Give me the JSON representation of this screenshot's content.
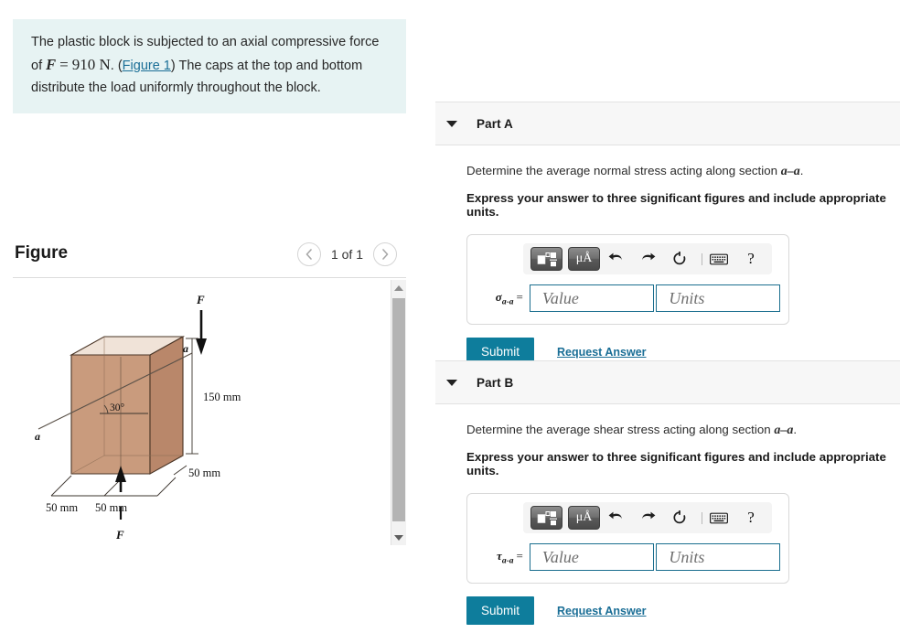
{
  "problem": {
    "text_before_var": "The plastic block is subjected to an axial compressive force of ",
    "force_var": "F",
    "equals": "=",
    "force_value": "910 N",
    "period": ".",
    "paren_open": "(",
    "figure_link": "Figure 1",
    "paren_close": ")",
    "text_after": " The caps at the top and bottom distribute the load uniformly throughout the block."
  },
  "figure": {
    "title": "Figure",
    "prev_icon": "chevron-left-icon",
    "next_icon": "chevron-right-icon",
    "counter": "1 of 1",
    "diagram": {
      "force_top_label": "F",
      "force_bottom_label": "F",
      "section_label_right": "a",
      "section_label_left": "a",
      "angle_label": "30°",
      "height_label": "150 mm",
      "depth_label": "50 mm",
      "width_label_1": "50 mm",
      "width_label_2": "50 mm",
      "front_face_color": "#c99b7d",
      "side_face_color": "#b9876a",
      "top_face_color": "#f0e3d8"
    },
    "scrollbar": {
      "up_icon": "triangle-up-icon",
      "down_icon": "triangle-down-icon"
    }
  },
  "parts": [
    {
      "id": "part-a",
      "label": "Part A",
      "caret_icon": "caret-down-icon",
      "prompt_before": "Determine the average normal stress acting along section ",
      "prompt_section": "a–a",
      "prompt_after": ".",
      "instruction": "Express your answer to three significant figures and include appropriate units.",
      "toolbar": {
        "template_icon": "math-template-icon",
        "units_icon": "micro-angstrom-units-icon",
        "units_text": "μÅ",
        "undo_icon": "undo-arrow-icon",
        "redo_icon": "redo-arrow-icon",
        "reset_icon": "reset-circle-icon",
        "keyboard_icon": "keyboard-icon",
        "help_icon": "question-mark-icon",
        "help_text": "?"
      },
      "variable_symbol": "σ",
      "variable_subscript": "a-a",
      "variable_equals": "=",
      "value_placeholder": "Value",
      "units_placeholder": "Units",
      "submit_label": "Submit",
      "request_answer_label": "Request Answer"
    },
    {
      "id": "part-b",
      "label": "Part B",
      "caret_icon": "caret-down-icon",
      "prompt_before": "Determine the average shear stress acting along section ",
      "prompt_section": "a–a",
      "prompt_after": ".",
      "instruction": "Express your answer to three significant figures and include appropriate units.",
      "toolbar": {
        "template_icon": "math-template-icon",
        "units_icon": "micro-angstrom-units-icon",
        "units_text": "μÅ",
        "undo_icon": "undo-arrow-icon",
        "redo_icon": "redo-arrow-icon",
        "reset_icon": "reset-circle-icon",
        "keyboard_icon": "keyboard-icon",
        "help_icon": "question-mark-icon",
        "help_text": "?"
      },
      "variable_symbol": "τ",
      "variable_subscript": "a-a",
      "variable_equals": "=",
      "value_placeholder": "Value",
      "units_placeholder": "Units",
      "submit_label": "Submit",
      "request_answer_label": "Request Answer"
    }
  ],
  "colors": {
    "statement_bg": "#e7f3f3",
    "part_header_bg": "#f7f7f7",
    "accent_teal": "#0e7d9c",
    "link_blue": "#1a6e96",
    "field_border": "#1a6e8e"
  }
}
